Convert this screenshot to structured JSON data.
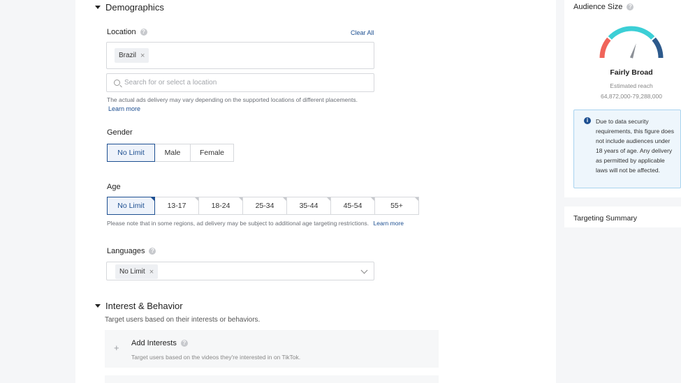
{
  "demographics": {
    "header": "Demographics",
    "location": {
      "label": "Location",
      "clear_all": "Clear All",
      "tags": [
        "Brazil"
      ],
      "search_placeholder": "Search for or select a location",
      "note": "The actual ads delivery may vary depending on the supported locations of different placements.",
      "learn_more": "Learn more"
    },
    "gender": {
      "label": "Gender",
      "options": [
        "No Limit",
        "Male",
        "Female"
      ],
      "selected": "No Limit"
    },
    "age": {
      "label": "Age",
      "options": [
        "No Limit",
        "13-17",
        "18-24",
        "25-34",
        "35-44",
        "45-54",
        "55+"
      ],
      "selected": "No Limit",
      "note": "Please note that in some regions, ad delivery may be subject to additional age targeting restrictions.",
      "learn_more": "Learn more"
    },
    "languages": {
      "label": "Languages",
      "tags": [
        "No Limit"
      ]
    }
  },
  "interest_behavior": {
    "header": "Interest & Behavior",
    "description": "Target users based on their interests or behaviors.",
    "add_interests": {
      "title": "Add Interests",
      "description": "Target users based on the videos they're interested in on TikTok."
    }
  },
  "audience_size": {
    "title": "Audience Size",
    "status": "Fairly Broad",
    "estimated_label": "Estimated reach",
    "range": "64,872,000-79,288,000",
    "level": 0.6,
    "info": "Due to data security requirements, this figure does not include audiences under 18 years of age. Any delivery as permitted by applicable laws will not be affected."
  },
  "targeting_summary": {
    "title": "Targeting Summary"
  },
  "colors": {
    "accent": "#1d4f91",
    "gauge_low": "#f0645a",
    "gauge_mid": "#3ccfd6",
    "gauge_high": "#2d5a8c"
  }
}
